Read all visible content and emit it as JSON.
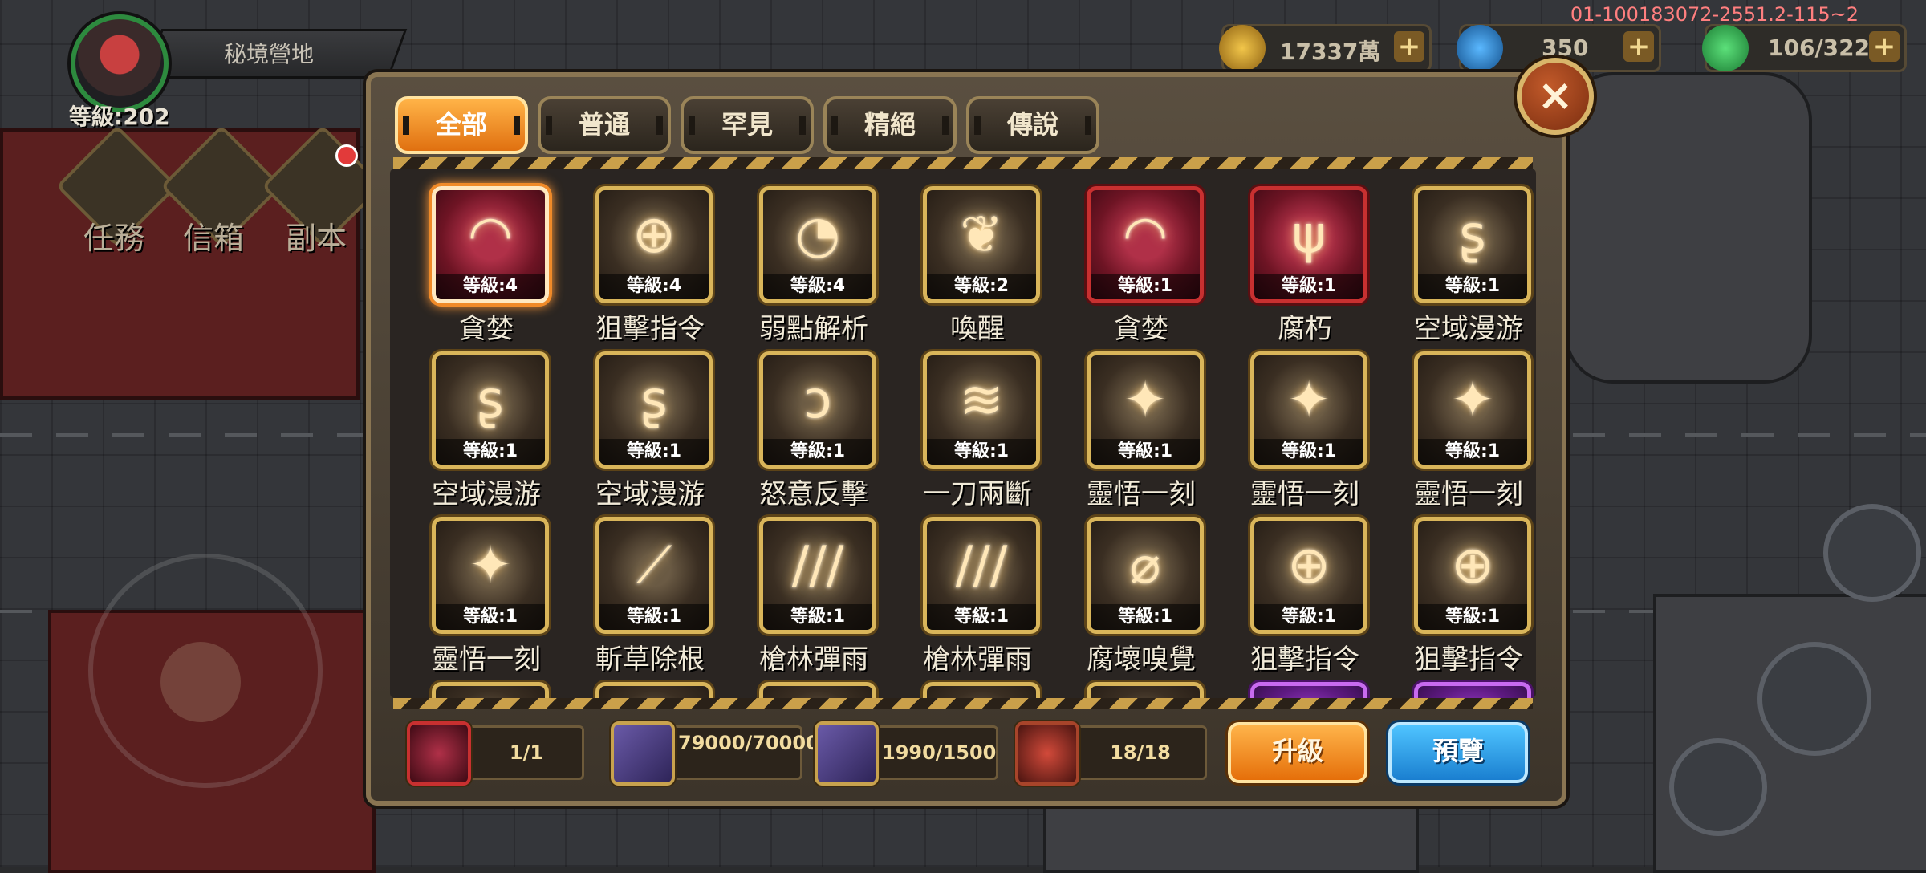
{
  "build_id": "01-100183072-2551.2-115~2",
  "player": {
    "location": "秘境營地",
    "level": "等級:202"
  },
  "menu": {
    "task": "任務",
    "mail": "信箱",
    "dungeon": "副本"
  },
  "currencies": {
    "gold": "17337萬",
    "gem": "350",
    "stamina": "106/322",
    "plus": "+"
  },
  "modal": {
    "close": "×",
    "tabs": [
      "全部",
      "普通",
      "罕見",
      "精絕",
      "傳說"
    ],
    "active_tab": 0,
    "skills": [
      {
        "name": "貪婪",
        "level": "等級:4",
        "rarity": "red",
        "selected": true,
        "icon": "maw-icon",
        "glyph": "◠"
      },
      {
        "name": "狙擊指令",
        "level": "等級:4",
        "rarity": "gold",
        "icon": "crosshair-icon",
        "glyph": "⊕"
      },
      {
        "name": "弱點解析",
        "level": "等級:4",
        "rarity": "gold",
        "icon": "gauge-icon",
        "glyph": "◔"
      },
      {
        "name": "喚醒",
        "level": "等級:2",
        "rarity": "gold",
        "icon": "sprout-icon",
        "glyph": "❦"
      },
      {
        "name": "貪婪",
        "level": "等級:1",
        "rarity": "red",
        "icon": "maw-icon",
        "glyph": "◠"
      },
      {
        "name": "腐朽",
        "level": "等級:1",
        "rarity": "red",
        "icon": "dead-tree-icon",
        "glyph": "ψ"
      },
      {
        "name": "空域漫游",
        "level": "等級:1",
        "rarity": "gold",
        "icon": "swirl-icon",
        "glyph": "ʂ"
      },
      {
        "name": "空域漫游",
        "level": "等級:1",
        "rarity": "gold",
        "icon": "swirl-icon",
        "glyph": "ʂ"
      },
      {
        "name": "空域漫游",
        "level": "等級:1",
        "rarity": "gold",
        "icon": "swirl-icon",
        "glyph": "ʂ"
      },
      {
        "name": "怒意反擊",
        "level": "等級:1",
        "rarity": "gold",
        "icon": "claw-icon",
        "glyph": "ↄ"
      },
      {
        "name": "一刀兩斷",
        "level": "等級:1",
        "rarity": "gold",
        "icon": "slash-icon",
        "glyph": "≋"
      },
      {
        "name": "靈悟一刻",
        "level": "等級:1",
        "rarity": "gold",
        "icon": "star-burst-icon",
        "glyph": "✦"
      },
      {
        "name": "靈悟一刻",
        "level": "等級:1",
        "rarity": "gold",
        "icon": "star-burst-icon",
        "glyph": "✦"
      },
      {
        "name": "靈悟一刻",
        "level": "等級:1",
        "rarity": "gold",
        "icon": "star-burst-icon",
        "glyph": "✦"
      },
      {
        "name": "靈悟一刻",
        "level": "等級:1",
        "rarity": "gold",
        "icon": "star-burst-icon",
        "glyph": "✦"
      },
      {
        "name": "斬草除根",
        "level": "等級:1",
        "rarity": "gold",
        "icon": "scythe-icon",
        "glyph": "⟋"
      },
      {
        "name": "槍林彈雨",
        "level": "等級:1",
        "rarity": "gold",
        "icon": "bullets-icon",
        "glyph": "∕∕∕"
      },
      {
        "name": "槍林彈雨",
        "level": "等級:1",
        "rarity": "gold",
        "icon": "bullets-icon",
        "glyph": "∕∕∕"
      },
      {
        "name": "腐壞嗅覺",
        "level": "等級:1",
        "rarity": "gold",
        "icon": "whirl-blade-icon",
        "glyph": "⌀"
      },
      {
        "name": "狙擊指令",
        "level": "等級:1",
        "rarity": "gold",
        "icon": "crosshair-icon",
        "glyph": "⊕"
      },
      {
        "name": "狙擊指令",
        "level": "等級:1",
        "rarity": "gold",
        "icon": "crosshair-icon",
        "glyph": "⊕"
      }
    ],
    "partial_row": [
      "gold",
      "gold",
      "gold",
      "gold",
      "gold",
      "purple",
      "purple"
    ]
  },
  "bottom": {
    "selected_count": "1/1",
    "material1": "79000/70000",
    "material2": "1990/1500",
    "material3": "18/18",
    "upgrade": "升級",
    "preview": "預覽"
  }
}
